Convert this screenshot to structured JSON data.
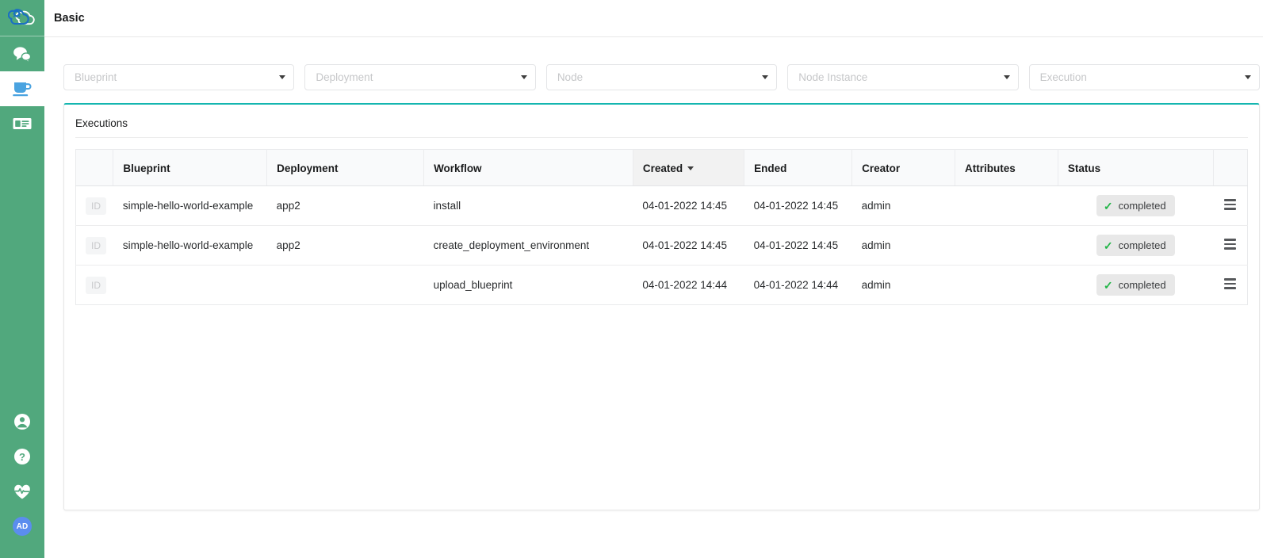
{
  "sidebar": {
    "logo": {
      "name": "cloudify-logo",
      "label": "Cloudify"
    },
    "items": [
      {
        "icon": "chat-bubbles-icon",
        "label": "Chat",
        "active": false
      },
      {
        "icon": "coffee-cup-icon",
        "label": "Deployments",
        "active": true
      },
      {
        "icon": "newspaper-icon",
        "label": "Logs",
        "active": false
      }
    ],
    "bottom_items": [
      {
        "icon": "user-circle-icon",
        "label": "Account"
      },
      {
        "icon": "help-circle-icon",
        "label": "Help"
      },
      {
        "icon": "heartbeat-icon",
        "label": "Status"
      }
    ],
    "avatar": {
      "initials": "AD",
      "color": "#5b8dee"
    },
    "background_color": "#51a87d"
  },
  "header": {
    "title": "Basic"
  },
  "filters": [
    {
      "name": "blueprint",
      "placeholder": "Blueprint",
      "value": ""
    },
    {
      "name": "deployment",
      "placeholder": "Deployment",
      "value": ""
    },
    {
      "name": "node",
      "placeholder": "Node",
      "value": ""
    },
    {
      "name": "node-instance",
      "placeholder": "Node Instance",
      "value": ""
    },
    {
      "name": "execution",
      "placeholder": "Execution",
      "value": ""
    }
  ],
  "panel": {
    "title": "Executions",
    "accent_color": "#15b6b0"
  },
  "table": {
    "columns": [
      {
        "key": "id",
        "label": "",
        "sorted": false
      },
      {
        "key": "blueprint",
        "label": "Blueprint",
        "sorted": false
      },
      {
        "key": "deployment",
        "label": "Deployment",
        "sorted": false
      },
      {
        "key": "workflow",
        "label": "Workflow",
        "sorted": false
      },
      {
        "key": "created",
        "label": "Created",
        "sorted": true,
        "sort_direction": "desc"
      },
      {
        "key": "ended",
        "label": "Ended",
        "sorted": false
      },
      {
        "key": "creator",
        "label": "Creator",
        "sorted": false
      },
      {
        "key": "attributes",
        "label": "Attributes",
        "sorted": false
      },
      {
        "key": "status",
        "label": "Status",
        "sorted": false
      },
      {
        "key": "menu",
        "label": "",
        "sorted": false
      }
    ],
    "rows": [
      {
        "id_chip": "ID",
        "blueprint": "simple-hello-world-example",
        "deployment": "app2",
        "workflow": "install",
        "created": "04-01-2022 14:45",
        "ended": "04-01-2022 14:45",
        "creator": "admin",
        "attributes": "",
        "status": "completed",
        "status_icon": "check-icon",
        "menu_icon": "hamburger-menu-icon"
      },
      {
        "id_chip": "ID",
        "blueprint": "simple-hello-world-example",
        "deployment": "app2",
        "workflow": "create_deployment_environment",
        "created": "04-01-2022 14:45",
        "ended": "04-01-2022 14:45",
        "creator": "admin",
        "attributes": "",
        "status": "completed",
        "status_icon": "check-icon",
        "menu_icon": "hamburger-menu-icon"
      },
      {
        "id_chip": "ID",
        "blueprint": "",
        "deployment": "",
        "workflow": "upload_blueprint",
        "created": "04-01-2022 14:44",
        "ended": "04-01-2022 14:44",
        "creator": "admin",
        "attributes": "",
        "status": "completed",
        "status_icon": "check-icon",
        "menu_icon": "hamburger-menu-icon"
      }
    ]
  }
}
